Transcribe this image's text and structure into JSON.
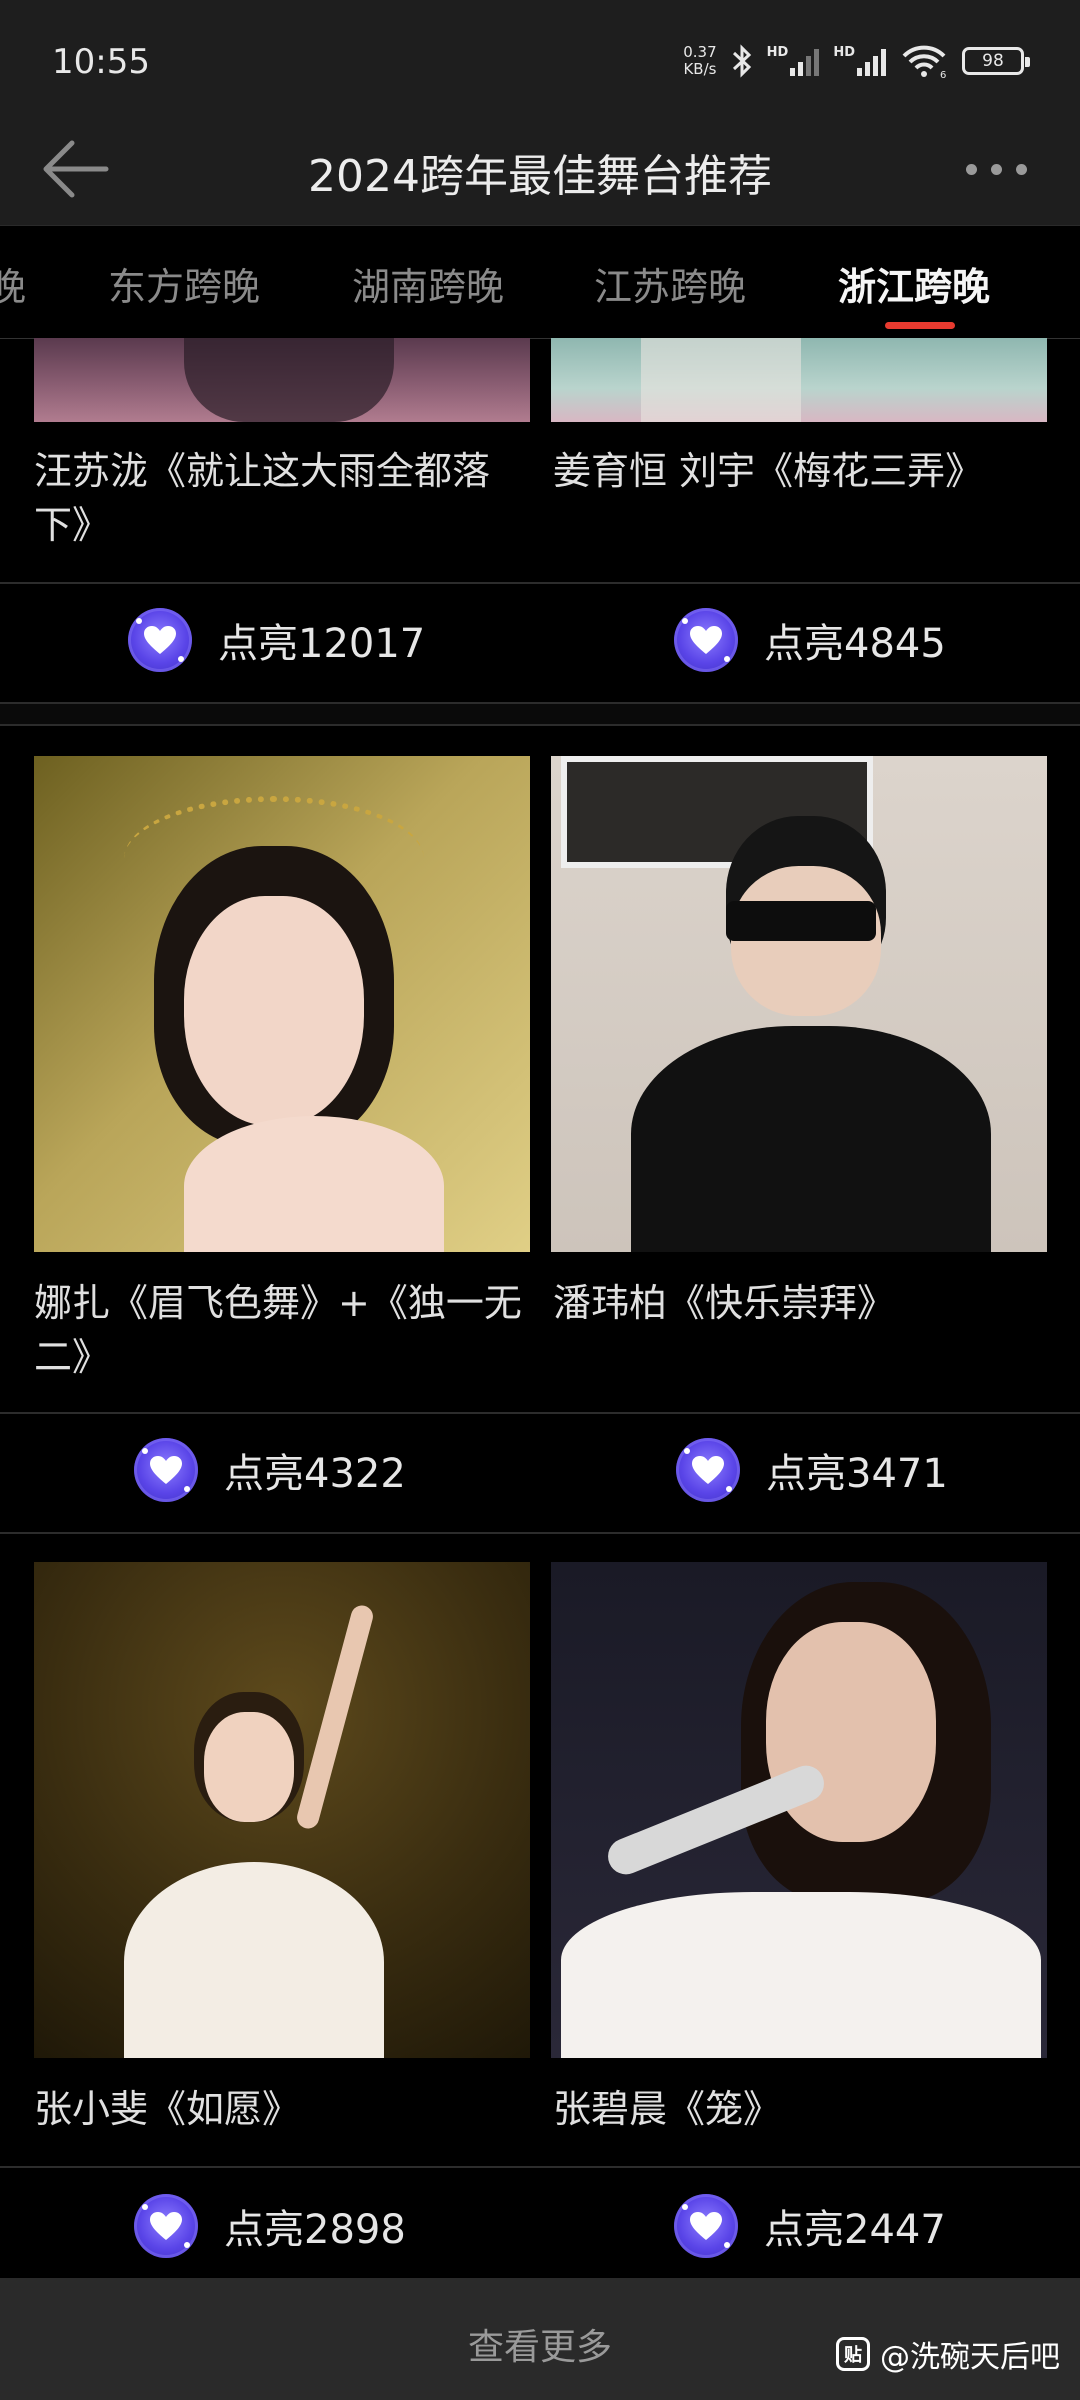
{
  "status_bar": {
    "time": "10:55",
    "net_speed_value": "0.37",
    "net_speed_unit": "KB/s",
    "hd_label": "HD",
    "wifi_badge": "6",
    "battery": "98"
  },
  "header": {
    "title": "2024跨年最佳舞台推荐"
  },
  "tabs": [
    {
      "label": "晚",
      "active": false
    },
    {
      "label": "东方跨晚",
      "active": false
    },
    {
      "label": "湖南跨晚",
      "active": false
    },
    {
      "label": "江苏跨晚",
      "active": false
    },
    {
      "label": "浙江跨晚",
      "active": true
    }
  ],
  "like_prefix": "点亮",
  "cards": [
    {
      "caption": "汪苏泷《就让这大雨全都落下》",
      "likes": "点亮12017"
    },
    {
      "caption": "姜育恒 刘宇《梅花三弄》",
      "likes": "点亮4845"
    },
    {
      "caption": "娜扎《眉飞色舞》+《独一无二》",
      "likes": "点亮4322"
    },
    {
      "caption": "潘玮柏《快乐崇拜》",
      "likes": "点亮3471"
    },
    {
      "caption": "张小斐《如愿》",
      "likes": "点亮2898"
    },
    {
      "caption": "张碧晨《笼》",
      "likes": "点亮2447"
    }
  ],
  "footer": {
    "view_more": "查看更多",
    "watermark_icon": "贴",
    "watermark_text": "@洗碗天后吧"
  },
  "colors": {
    "accent": "#e83a2f",
    "like_button": "#6a55f0",
    "background": "#000000",
    "bar": "#1e1e1e"
  }
}
